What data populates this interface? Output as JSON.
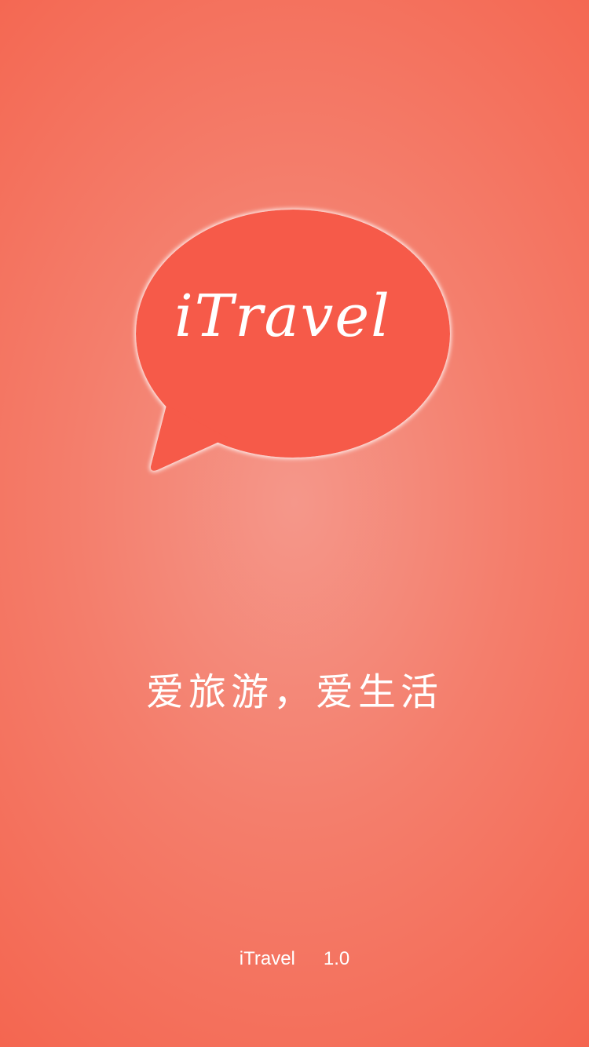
{
  "splash": {
    "logo_text": "iTravel",
    "slogan": "爱旅游，爱生活",
    "app_name": "iTravel",
    "version": "1.0"
  },
  "colors": {
    "background_center": "#f5978a",
    "background_edge": "#f4654f",
    "bubble": "#f65a48",
    "text": "#ffffff"
  },
  "icons": {
    "logo": "speech-bubble-icon"
  }
}
